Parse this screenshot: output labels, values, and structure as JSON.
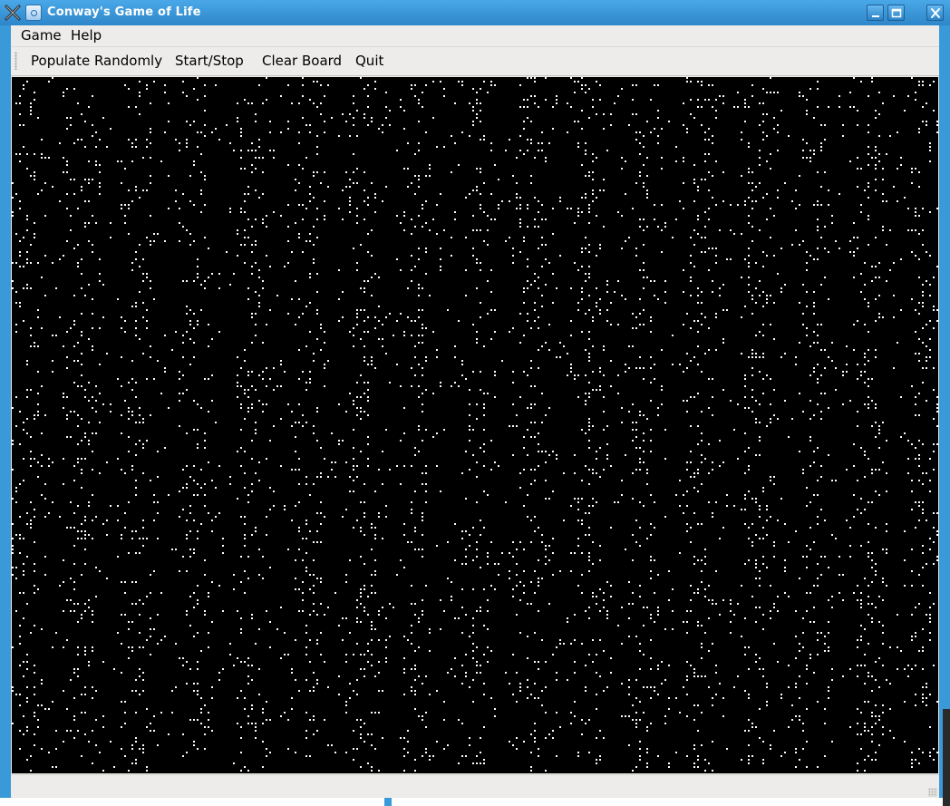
{
  "window": {
    "title": "Conway's Game of Life",
    "accent_color": "#3a9ad9",
    "icons": [
      "window-manager-icon",
      "app-icon",
      "minimize-icon",
      "maximize-icon",
      "close-icon"
    ]
  },
  "menubar": {
    "items": [
      {
        "label": "Game"
      },
      {
        "label": "Help"
      }
    ]
  },
  "toolbar": {
    "buttons": [
      {
        "label": "Populate Randomly"
      },
      {
        "label": "Start/Stop"
      },
      {
        "label": "Clear Board"
      },
      {
        "label": "Quit"
      }
    ]
  },
  "board": {
    "background_color": "#000000",
    "cell_color": "#ffffff",
    "live_cell_fraction": 0.12
  },
  "statusbar": {
    "text": ""
  }
}
